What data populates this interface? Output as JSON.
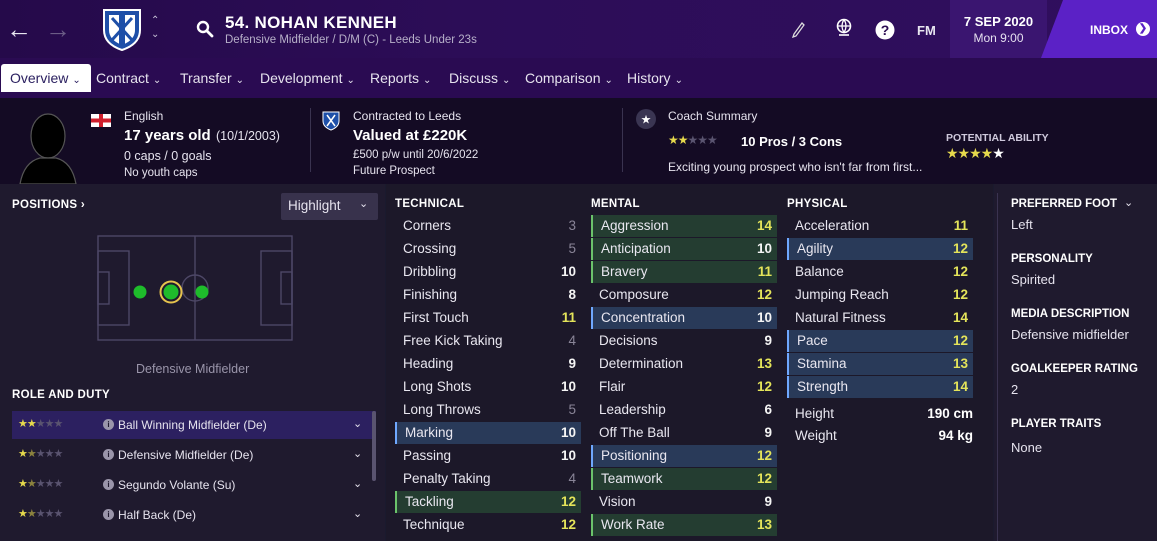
{
  "header": {
    "player_name": "54. NOHAN KENNEH",
    "player_subtitle": "Defensive Midfielder / D/M (C) - Leeds Under 23s",
    "fm_label": "FM",
    "date": "7 SEP 2020",
    "time": "Mon 9:00",
    "inbox_label": "INBOX"
  },
  "tabs": [
    {
      "label": "Overview"
    },
    {
      "label": "Contract"
    },
    {
      "label": "Transfer"
    },
    {
      "label": "Development"
    },
    {
      "label": "Reports"
    },
    {
      "label": "Discuss"
    },
    {
      "label": "Comparison"
    },
    {
      "label": "History"
    }
  ],
  "info": {
    "nationality": "English",
    "age": "17 years old",
    "dob": "(10/1/2003)",
    "caps": "0 caps / 0 goals",
    "youth_caps": "No youth caps",
    "contract_title": "Contracted to Leeds",
    "valued_at": "Valued at £220K",
    "wage": "£500 p/w until 20/6/2022",
    "future": "Future Prospect",
    "coach_summary_title": "Coach Summary",
    "pros_cons": "10 Pros / 3 Cons",
    "coach_text": "Exciting young prospect who isn't far from first...",
    "coach_stars": 2.0,
    "potential_title": "POTENTIAL ABILITY",
    "potential_stars": 4.0
  },
  "positions": {
    "title": "POSITIONS",
    "highlight_label": "Highlight",
    "position_label": "Defensive Midfielder"
  },
  "roles": {
    "title": "ROLE AND DUTY",
    "items": [
      {
        "name": "Ball Winning Midfielder (De)",
        "stars": 2.0
      },
      {
        "name": "Defensive Midfielder (De)",
        "stars": 1.5
      },
      {
        "name": "Segundo Volante (Su)",
        "stars": 1.5
      },
      {
        "name": "Half Back (De)",
        "stars": 1.5
      }
    ]
  },
  "technical": {
    "title": "TECHNICAL",
    "items": [
      {
        "name": "Corners",
        "value": "3",
        "color": "grey",
        "hl": ""
      },
      {
        "name": "Crossing",
        "value": "5",
        "color": "grey",
        "hl": ""
      },
      {
        "name": "Dribbling",
        "value": "10",
        "color": "white",
        "hl": ""
      },
      {
        "name": "Finishing",
        "value": "8",
        "color": "white",
        "hl": ""
      },
      {
        "name": "First Touch",
        "value": "11",
        "color": "yellow",
        "hl": ""
      },
      {
        "name": "Free Kick Taking",
        "value": "4",
        "color": "grey",
        "hl": ""
      },
      {
        "name": "Heading",
        "value": "9",
        "color": "white",
        "hl": ""
      },
      {
        "name": "Long Shots",
        "value": "10",
        "color": "white",
        "hl": ""
      },
      {
        "name": "Long Throws",
        "value": "5",
        "color": "grey",
        "hl": ""
      },
      {
        "name": "Marking",
        "value": "10",
        "color": "white",
        "hl": "blue"
      },
      {
        "name": "Passing",
        "value": "10",
        "color": "white",
        "hl": ""
      },
      {
        "name": "Penalty Taking",
        "value": "4",
        "color": "grey",
        "hl": ""
      },
      {
        "name": "Tackling",
        "value": "12",
        "color": "yellow",
        "hl": "green"
      },
      {
        "name": "Technique",
        "value": "12",
        "color": "yellow",
        "hl": ""
      }
    ]
  },
  "mental": {
    "title": "MENTAL",
    "items": [
      {
        "name": "Aggression",
        "value": "14",
        "color": "yellow",
        "hl": "green"
      },
      {
        "name": "Anticipation",
        "value": "10",
        "color": "white",
        "hl": "green"
      },
      {
        "name": "Bravery",
        "value": "11",
        "color": "yellow",
        "hl": "green"
      },
      {
        "name": "Composure",
        "value": "12",
        "color": "yellow",
        "hl": ""
      },
      {
        "name": "Concentration",
        "value": "10",
        "color": "white",
        "hl": "blue"
      },
      {
        "name": "Decisions",
        "value": "9",
        "color": "white",
        "hl": ""
      },
      {
        "name": "Determination",
        "value": "13",
        "color": "yellow",
        "hl": ""
      },
      {
        "name": "Flair",
        "value": "12",
        "color": "yellow",
        "hl": ""
      },
      {
        "name": "Leadership",
        "value": "6",
        "color": "white",
        "hl": ""
      },
      {
        "name": "Off The Ball",
        "value": "9",
        "color": "white",
        "hl": ""
      },
      {
        "name": "Positioning",
        "value": "12",
        "color": "yellow",
        "hl": "blue"
      },
      {
        "name": "Teamwork",
        "value": "12",
        "color": "yellow",
        "hl": "green"
      },
      {
        "name": "Vision",
        "value": "9",
        "color": "white",
        "hl": ""
      },
      {
        "name": "Work Rate",
        "value": "13",
        "color": "yellow",
        "hl": "green"
      }
    ]
  },
  "physical": {
    "title": "PHYSICAL",
    "items": [
      {
        "name": "Acceleration",
        "value": "11",
        "color": "yellow",
        "hl": ""
      },
      {
        "name": "Agility",
        "value": "12",
        "color": "yellow",
        "hl": "blue"
      },
      {
        "name": "Balance",
        "value": "12",
        "color": "yellow",
        "hl": ""
      },
      {
        "name": "Jumping Reach",
        "value": "12",
        "color": "yellow",
        "hl": ""
      },
      {
        "name": "Natural Fitness",
        "value": "14",
        "color": "yellow",
        "hl": ""
      },
      {
        "name": "Pace",
        "value": "12",
        "color": "yellow",
        "hl": "blue"
      },
      {
        "name": "Stamina",
        "value": "13",
        "color": "yellow",
        "hl": "blue"
      },
      {
        "name": "Strength",
        "value": "14",
        "color": "yellow",
        "hl": "blue"
      }
    ],
    "height_label": "Height",
    "height_value": "190 cm",
    "weight_label": "Weight",
    "weight_value": "94 kg"
  },
  "side": {
    "preferred_foot_label": "PREFERRED FOOT",
    "preferred_foot": "Left",
    "personality_label": "PERSONALITY",
    "personality": "Spirited",
    "media_label": "MEDIA DESCRIPTION",
    "media": "Defensive midfielder",
    "gk_label": "GOALKEEPER RATING",
    "gk": "2",
    "traits_label": "PLAYER TRAITS",
    "traits": "None"
  },
  "colors": {
    "accent": "#5b21c6",
    "highlight_green": "#6bc36b",
    "highlight_blue": "#6fa8ff",
    "value_yellow": "#e4e45a"
  }
}
